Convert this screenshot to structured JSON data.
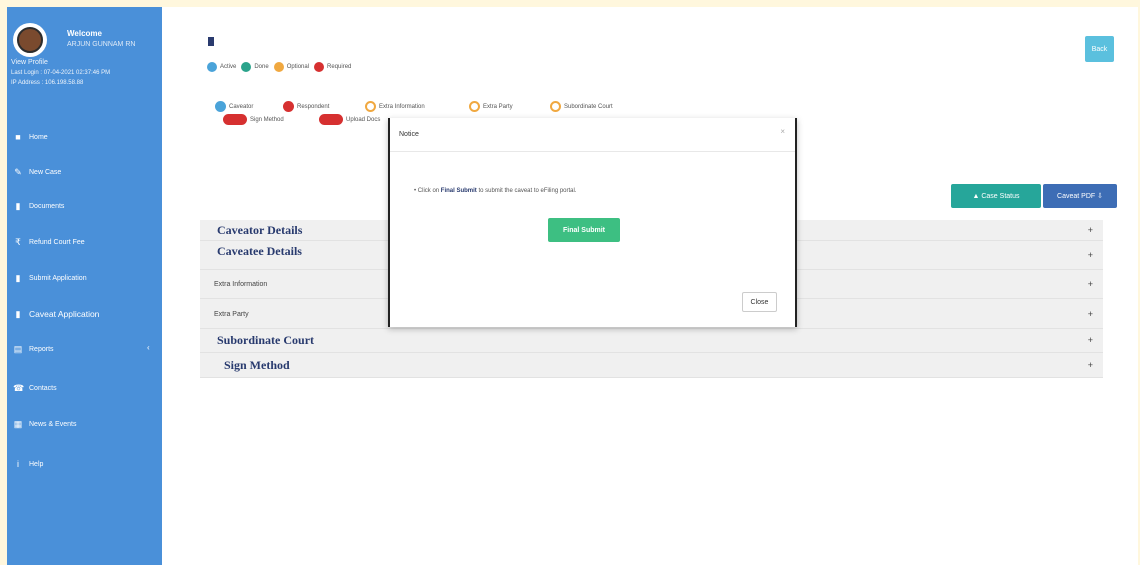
{
  "sidebar": {
    "welcome": "Welcome",
    "username": "ARJUN GUNNAM RN",
    "view_profile": "View Profile",
    "last_login": "Last Login : 07-04-2021 02:37:46 PM",
    "ip_address": "IP Address : 106.198.58.88",
    "items": [
      {
        "label": "Home",
        "icon": "home-icon"
      },
      {
        "label": "New Case",
        "icon": "edit-icon"
      },
      {
        "label": "Documents",
        "icon": "document-icon"
      },
      {
        "label": "Refund Court Fee",
        "icon": "rupee-icon"
      },
      {
        "label": "Submit Application",
        "icon": "document-icon"
      },
      {
        "label": "Caveat Application",
        "icon": "document-icon"
      },
      {
        "label": "Reports",
        "icon": "report-icon"
      },
      {
        "label": "Contacts",
        "icon": "contacts-icon"
      },
      {
        "label": "News & Events",
        "icon": "news-icon"
      },
      {
        "label": "Help",
        "icon": "help-icon"
      }
    ]
  },
  "header": {
    "legend": [
      {
        "label": "Active",
        "color": "#4aa3d9"
      },
      {
        "label": "Done",
        "color": "#2aa38b"
      },
      {
        "label": "Optional",
        "color": "#f0a840"
      },
      {
        "label": "Required",
        "color": "#d63030"
      }
    ],
    "back_label": "Back"
  },
  "steps": [
    {
      "label": "Caveator",
      "color": "#4aa3d9"
    },
    {
      "label": "Respondent",
      "color": "#d63030"
    },
    {
      "label": "Extra Information",
      "color": "#f0a840"
    },
    {
      "label": "Extra Party",
      "color": "#f0a840"
    },
    {
      "label": "Subordinate Court",
      "color": "#f0a840"
    },
    {
      "label": "Sign Method",
      "color": "#d63030"
    },
    {
      "label": "Upload Docs",
      "color": "#d63030"
    }
  ],
  "actions": {
    "case_status": "Case Status",
    "caveat_pdf": "Caveat PDF"
  },
  "accordion": [
    {
      "label": "Caveator Details"
    },
    {
      "label": "Caveatee Details"
    },
    {
      "label": "Extra Information"
    },
    {
      "label": "Extra Party"
    },
    {
      "label": "Subordinate Court"
    },
    {
      "label": "Sign Method"
    }
  ],
  "modal": {
    "title": "Notice",
    "message_prefix": "Click on ",
    "message_bold": "Final Submit",
    "message_suffix": " to submit the caveat to eFiling portal.",
    "final_submit": "Final Submit",
    "close": "Close"
  }
}
